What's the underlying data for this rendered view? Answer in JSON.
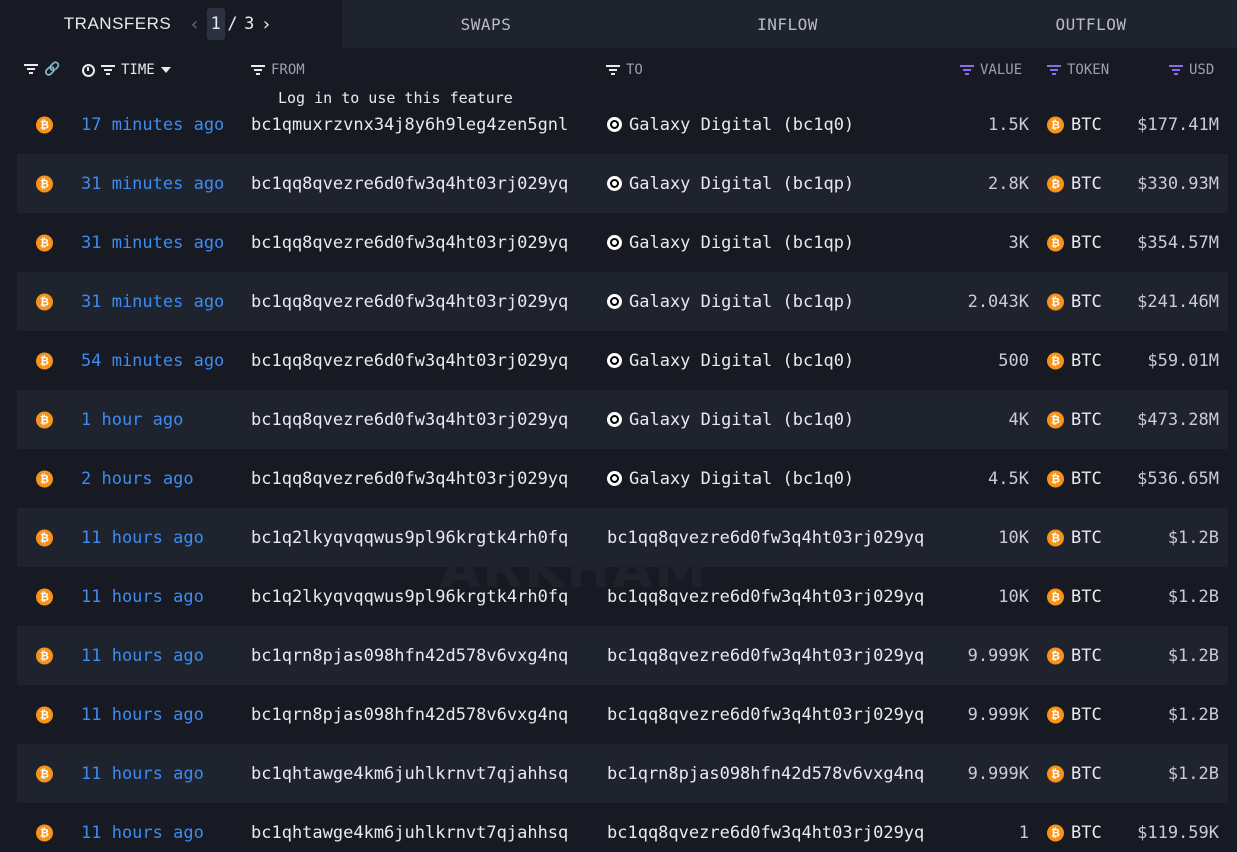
{
  "tabs": {
    "transfers": "TRANSFERS",
    "swaps": "SWAPS",
    "inflow": "INFLOW",
    "outflow": "OUTFLOW",
    "page_current": "1",
    "page_total": "3"
  },
  "columns": {
    "time": "TIME",
    "from": "FROM",
    "to": "TO",
    "value": "VALUE",
    "token": "TOKEN",
    "usd": "USD"
  },
  "tooltip": "Log in to use this feature",
  "watermark": "ARKHAM",
  "colors": {
    "btc": "#f7931a",
    "time_link": "#3b8cf3",
    "filter_active": "#8a6ee8"
  },
  "rows": [
    {
      "time": "17 minutes ago",
      "from": "bc1qmuxrzvnx34j8y6h9leg4zen5gnl",
      "to": "Galaxy Digital (bc1q0)",
      "to_entity": true,
      "value": "1.5K",
      "token": "BTC",
      "usd": "$177.41M"
    },
    {
      "time": "31 minutes ago",
      "from": "bc1qq8qvezre6d0fw3q4ht03rj029yq",
      "to": "Galaxy Digital (bc1qp)",
      "to_entity": true,
      "value": "2.8K",
      "token": "BTC",
      "usd": "$330.93M"
    },
    {
      "time": "31 minutes ago",
      "from": "bc1qq8qvezre6d0fw3q4ht03rj029yq",
      "to": "Galaxy Digital (bc1qp)",
      "to_entity": true,
      "value": "3K",
      "token": "BTC",
      "usd": "$354.57M"
    },
    {
      "time": "31 minutes ago",
      "from": "bc1qq8qvezre6d0fw3q4ht03rj029yq",
      "to": "Galaxy Digital (bc1qp)",
      "to_entity": true,
      "value": "2.043K",
      "token": "BTC",
      "usd": "$241.46M"
    },
    {
      "time": "54 minutes ago",
      "from": "bc1qq8qvezre6d0fw3q4ht03rj029yq",
      "to": "Galaxy Digital (bc1q0)",
      "to_entity": true,
      "value": "500",
      "token": "BTC",
      "usd": "$59.01M"
    },
    {
      "time": "1 hour ago",
      "from": "bc1qq8qvezre6d0fw3q4ht03rj029yq",
      "to": "Galaxy Digital (bc1q0)",
      "to_entity": true,
      "value": "4K",
      "token": "BTC",
      "usd": "$473.28M"
    },
    {
      "time": "2 hours ago",
      "from": "bc1qq8qvezre6d0fw3q4ht03rj029yq",
      "to": "Galaxy Digital (bc1q0)",
      "to_entity": true,
      "value": "4.5K",
      "token": "BTC",
      "usd": "$536.65M"
    },
    {
      "time": "11 hours ago",
      "from": "bc1q2lkyqvqqwus9pl96krgtk4rh0fq",
      "to": "bc1qq8qvezre6d0fw3q4ht03rj029yq",
      "to_entity": false,
      "value": "10K",
      "token": "BTC",
      "usd": "$1.2B"
    },
    {
      "time": "11 hours ago",
      "from": "bc1q2lkyqvqqwus9pl96krgtk4rh0fq",
      "to": "bc1qq8qvezre6d0fw3q4ht03rj029yq",
      "to_entity": false,
      "value": "10K",
      "token": "BTC",
      "usd": "$1.2B"
    },
    {
      "time": "11 hours ago",
      "from": "bc1qrn8pjas098hfn42d578v6vxg4nq",
      "to": "bc1qq8qvezre6d0fw3q4ht03rj029yq",
      "to_entity": false,
      "value": "9.999K",
      "token": "BTC",
      "usd": "$1.2B"
    },
    {
      "time": "11 hours ago",
      "from": "bc1qrn8pjas098hfn42d578v6vxg4nq",
      "to": "bc1qq8qvezre6d0fw3q4ht03rj029yq",
      "to_entity": false,
      "value": "9.999K",
      "token": "BTC",
      "usd": "$1.2B"
    },
    {
      "time": "11 hours ago",
      "from": "bc1qhtawge4km6juhlkrnvt7qjahhsq",
      "to": "bc1qrn8pjas098hfn42d578v6vxg4nq",
      "to_entity": false,
      "value": "9.999K",
      "token": "BTC",
      "usd": "$1.2B"
    },
    {
      "time": "11 hours ago",
      "from": "bc1qhtawge4km6juhlkrnvt7qjahhsq",
      "to": "bc1qq8qvezre6d0fw3q4ht03rj029yq",
      "to_entity": false,
      "value": "1",
      "token": "BTC",
      "usd": "$119.59K"
    }
  ]
}
